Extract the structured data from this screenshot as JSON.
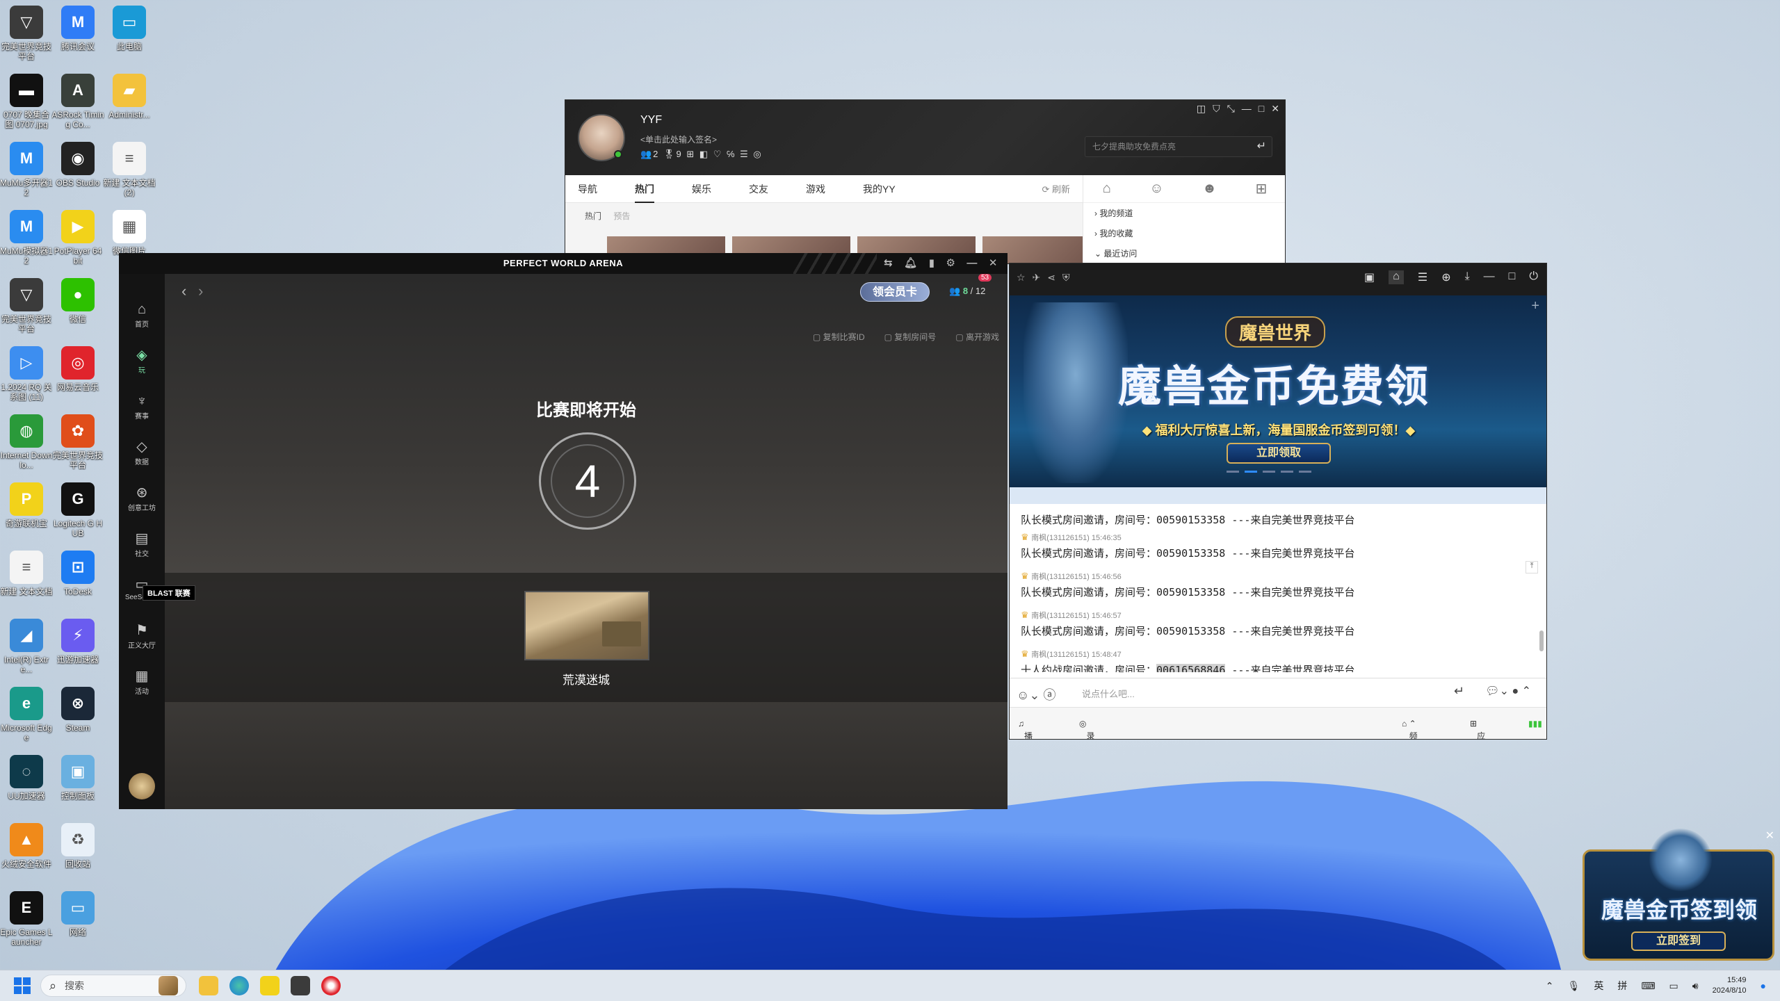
{
  "desktop_icons": [
    {
      "label": "完美世界竞技平台",
      "color": "#3b3b3b",
      "glyph": "▽"
    },
    {
      "label": "腾讯会议",
      "color": "#2f7cf6",
      "glyph": "M"
    },
    {
      "label": "此电脑",
      "color": "#1a9ad6",
      "glyph": "▭"
    },
    {
      "label": "0707 晚集合图 0707.jpg",
      "color": "#111",
      "glyph": "▬"
    },
    {
      "label": "ASRock Timing Co...",
      "color": "#39403a",
      "glyph": "A"
    },
    {
      "label": "Administr...",
      "color": "#f3c23c",
      "glyph": "▰"
    },
    {
      "label": "MuMu多开器12",
      "color": "#2a8cf0",
      "glyph": "M"
    },
    {
      "label": "OBS Studio",
      "color": "#222",
      "glyph": "◉"
    },
    {
      "label": "新建 文本文档 (2)",
      "color": "#f4f4f4",
      "glyph": "≡"
    },
    {
      "label": "MuMu模拟器12",
      "color": "#2a8cf0",
      "glyph": "M"
    },
    {
      "label": "PotPlayer 64 bit",
      "color": "#f2d21a",
      "glyph": "▶"
    },
    {
      "label": "微信图片",
      "color": "#ffffff",
      "glyph": "▦"
    },
    {
      "label": "完美世界竞技平台",
      "color": "#3b3b3b",
      "glyph": "▽"
    },
    {
      "label": "微信",
      "color": "#2dc100",
      "glyph": "●"
    },
    {
      "label": "1.2024 RQ 关系图 (11)",
      "color": "#3d8ef0",
      "glyph": "▷"
    },
    {
      "label": "网易云音乐",
      "color": "#e0242c",
      "glyph": "◎"
    },
    {
      "label": "Internet Downlo...",
      "color": "#2a9a3a",
      "glyph": "◍"
    },
    {
      "label": "完美世界竞技平台",
      "color": "#e04e1a",
      "glyph": "✿"
    },
    {
      "label": "奇游联机宝",
      "color": "#f2d21a",
      "glyph": "P"
    },
    {
      "label": "Logitech G HUB",
      "color": "#111",
      "glyph": "G"
    },
    {
      "label": "新建 文本文档",
      "color": "#f4f4f4",
      "glyph": "≡"
    },
    {
      "label": "ToDesk",
      "color": "#1e7cf2",
      "glyph": "⊡"
    },
    {
      "label": "Intel(R) Extre...",
      "color": "#3a8ad8",
      "glyph": "◢"
    },
    {
      "label": "迅游加速器",
      "color": "#6a5cf0",
      "glyph": "⚡"
    },
    {
      "label": "Microsoft Edge",
      "color": "#1a9a8a",
      "glyph": "e"
    },
    {
      "label": "Steam",
      "color": "#1b2838",
      "glyph": "⊗"
    },
    {
      "label": "UU加速器",
      "color": "#0e3a4a",
      "glyph": "◌"
    },
    {
      "label": "控制面板",
      "color": "#6ab0e0",
      "glyph": "▣"
    },
    {
      "label": "火绒安全软件",
      "color": "#f08a1a",
      "glyph": "▲"
    },
    {
      "label": "回收站",
      "color": "#e8f0f8",
      "glyph": "♻"
    },
    {
      "label": "Epic Games Launcher",
      "color": "#111",
      "glyph": "E"
    },
    {
      "label": "网络",
      "color": "#4aa0e0",
      "glyph": "▭"
    }
  ],
  "yy_main": {
    "username": "YYF",
    "signature": "<单击此处输入签名>",
    "badges": "👥2 🎖9 ⊞ ◧ ♡ ℅ ☰ ◎",
    "search_placeholder": "七夕提典助攻免费点亮",
    "tabs": [
      "导航",
      "热门",
      "娱乐",
      "交友",
      "游戏",
      "我的YY"
    ],
    "active_tab": "热门",
    "refresh": "刷新",
    "subtabs": [
      "热门",
      "预告"
    ],
    "side_items": [
      "我的频道",
      "我的收藏",
      "最近访问"
    ]
  },
  "pwa": {
    "title": "PERFECT WORLD ARENA",
    "member_badge": "领会员卡",
    "player_count_cur": "8",
    "player_count_total": "/ 12",
    "notif_count": "53",
    "room_actions": [
      "复制比赛ID",
      "复制房间号",
      "离开游戏"
    ],
    "countdown_title": "比赛即将开始",
    "countdown_value": "4",
    "map_name": "荒漠迷城",
    "blast_tag": "BLAST 联赛",
    "nav": [
      {
        "icon": "⌂",
        "label": "首页",
        "name": "nav-home"
      },
      {
        "icon": "◈",
        "label": "玩",
        "name": "nav-play"
      },
      {
        "icon": "♆",
        "label": "赛事",
        "name": "nav-events"
      },
      {
        "icon": "◇",
        "label": "数据",
        "name": "nav-data"
      },
      {
        "icon": "⊛",
        "label": "创意工坊",
        "name": "nav-workshop"
      },
      {
        "icon": "▤",
        "label": "社交",
        "name": "nav-social"
      },
      {
        "icon": "▭",
        "label": "SeeSeeTV",
        "name": "nav-tv"
      },
      {
        "icon": "⚑",
        "label": "正义大厅",
        "name": "nav-justice"
      },
      {
        "icon": "▦",
        "label": "活动",
        "name": "nav-activity"
      }
    ]
  },
  "channel": {
    "banner_logo": "魔兽世界",
    "banner_title": "魔兽金币免费领",
    "banner_subtitle": "◆ 福利大厅惊喜上新，海量国服金币签到可领！◆",
    "banner_button": "立即领取",
    "messages": [
      {
        "meta": "",
        "text": "队长模式房间邀请，房间号：00590153358 ---来自完美世界竞技平台"
      },
      {
        "meta": "南枫(131126151) 15:46:35",
        "text": "队长模式房间邀请，房间号：00590153358 ---来自完美世界竞技平台"
      },
      {
        "meta": "南枫(131126151) 15:46:56",
        "text": "队长模式房间邀请，房间号：00590153358 ---来自完美世界竞技平台"
      },
      {
        "meta": "南枫(131126151) 15:46:57",
        "text": "队长模式房间邀请，房间号：00590153358 ---来自完美世界竞技平台"
      },
      {
        "meta": "南枫(131126151) 15:48:47",
        "text_before": "十人约战房间邀请，房间号：",
        "text_highlight": "00616568846",
        "text_after": " ---来自完美世界竞技平台"
      }
    ],
    "input_placeholder": "说点什么吧...",
    "bottom_items": [
      "播放伴奏",
      "录音",
      "频道模板",
      "应用中心"
    ]
  },
  "ad": {
    "text": "魔兽金币签到领",
    "button": "立即签到"
  },
  "taskbar": {
    "search_label": "搜索",
    "tray_lang": "英",
    "tray_ime": "拼",
    "time": "15:49",
    "date": "2024/8/10"
  }
}
